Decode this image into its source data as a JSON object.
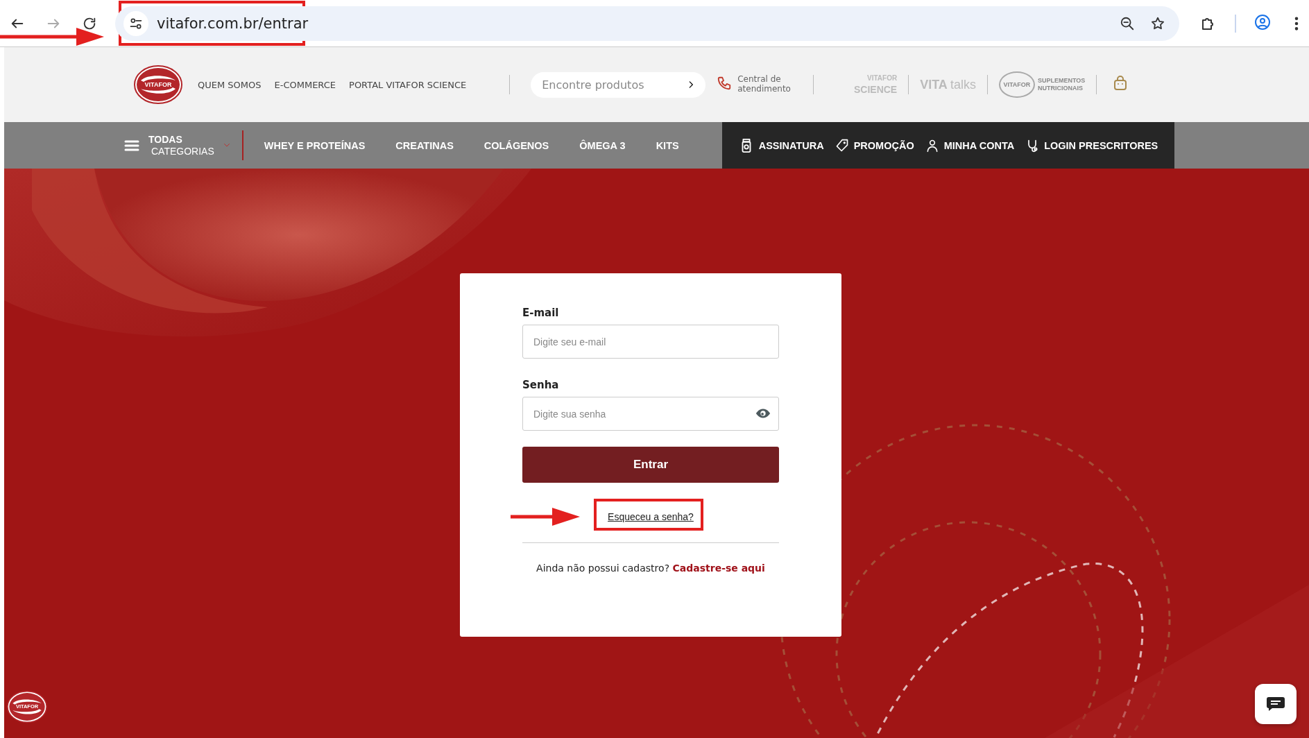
{
  "browser": {
    "forward": {
      "disabled": true
    },
    "url": "vitafor.com.br/entrar",
    "url_highlighted": true
  },
  "header": {
    "logo": "VITAFOR",
    "links": [
      "QUEM SOMOS",
      "E-COMMERCE",
      "PORTAL VITAFOR SCIENCE"
    ],
    "search": {
      "placeholder": "Encontre produtos"
    },
    "help": [
      "Central de",
      "atendimento"
    ],
    "brands": [
      {
        "kind": "science",
        "lines": [
          "VITAFOR",
          "SCIENCE"
        ]
      },
      {
        "kind": "talks",
        "lines": [
          "VITA",
          "talks"
        ]
      },
      {
        "kind": "supplements",
        "lines": [
          "VITAFOR",
          "SUPLEMENTOS",
          "NUTRICIONAIS"
        ]
      }
    ]
  },
  "nav": {
    "categories": [
      "TODAS",
      "CATEGORIAS"
    ],
    "items": [
      "WHEY E PROTEÍNAS",
      "CREATINAS",
      "COLÁGENOS",
      "ÔMEGA 3",
      "KITS"
    ],
    "account_items": [
      {
        "kind": "subscription",
        "label": "ASSINATURA"
      },
      {
        "kind": "promotion",
        "label": "PROMOÇÃO"
      },
      {
        "kind": "account",
        "label": "MINHA CONTA"
      },
      {
        "kind": "prescribers",
        "label": "LOGIN PRESCRITORES"
      }
    ]
  },
  "login": {
    "email": {
      "label": "E-mail",
      "placeholder": "Digite seu e-mail"
    },
    "password": {
      "label": "Senha",
      "placeholder": "Digite sua senha"
    },
    "submit": "Entrar",
    "forgot": "Esqueceu a senha?",
    "forgot_highlighted": true,
    "signup": {
      "text": "Ainda não possui cadastro?",
      "link": "Cadastre-se aqui"
    }
  },
  "floating": {
    "badge": "VITAFOR"
  }
}
